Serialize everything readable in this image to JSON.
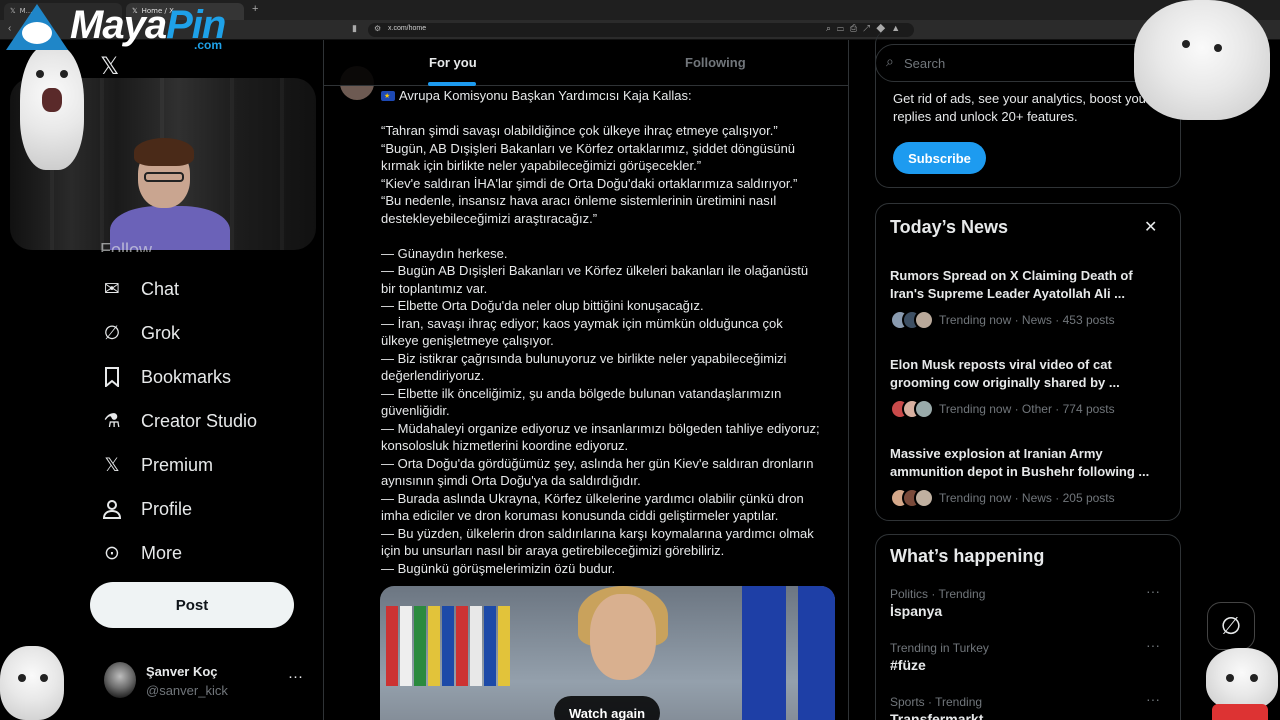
{
  "browser": {
    "tabs": [
      {
        "label": "M...",
        "active": false
      },
      {
        "label": "Home / X",
        "active": true
      }
    ],
    "new_tab": "+",
    "url": "x.com/home"
  },
  "overlay": {
    "logo_text_a": "Maya",
    "logo_text_b": "Pin",
    "logo_suffix": ".com"
  },
  "sidebar": {
    "partial_item": "Follow",
    "items": [
      {
        "label": "Chat",
        "icon": "mail-icon"
      },
      {
        "label": "Grok",
        "icon": "grok-icon"
      },
      {
        "label": "Bookmarks",
        "icon": "bookmark-icon"
      },
      {
        "label": "Creator Studio",
        "icon": "flask-icon"
      },
      {
        "label": "Premium",
        "icon": "x-logo-icon"
      },
      {
        "label": "Profile",
        "icon": "person-icon"
      },
      {
        "label": "More",
        "icon": "more-circle-icon"
      }
    ],
    "post_label": "Post",
    "account": {
      "name": "Şanver Koç",
      "handle": "@sanver_kick",
      "more": "···"
    }
  },
  "main": {
    "tabs": [
      {
        "label": "For you",
        "active": true
      },
      {
        "label": "Following",
        "active": false
      }
    ],
    "tweet": {
      "lines": [
        "Avrupa Komisyonu Başkan Yardımcısı Kaja Kallas:",
        "",
        "“Tahran şimdi savaşı olabildiğince çok ülkeye ihraç etmeye çalışıyor.”",
        "“Bugün, AB Dışişleri Bakanları ve Körfez ortaklarımız, şiddet döngüsünü",
        "kırmak için birlikte neler yapabileceğimizi görüşecekler.”",
        "“Kiev'e saldıran İHA'lar şimdi de Orta Doğu'daki ortaklarımıza saldırıyor.”",
        "“Bu nedenle, insansız hava aracı önleme sistemlerinin üretimini nasıl",
        "destekleyebileceğimizi araştıracağız.”",
        "",
        "— Günaydın herkese.",
        "— Bugün AB Dışişleri Bakanları ve Körfez ülkeleri bakanları ile olağanüstü",
        "bir toplantımız var.",
        "— Elbette Orta Doğu'da neler olup bittiğini konuşacağız.",
        "— İran, savaşı ihraç ediyor; kaos yaymak için mümkün olduğunca çok",
        "ülkeye genişletmeye çalışıyor.",
        "— Biz istikrar çağrısında bulunuyoruz ve birlikte neler yapabileceğimizi",
        "değerlendiriyoruz.",
        "— Elbette ilk önceliğimiz, şu anda bölgede bulunan vatandaşlarımızın",
        "güvenliğidir.",
        "— Müdahaleyi organize ediyoruz ve insanlarımızı bölgeden tahliye ediyoruz;",
        "konsolosluk hizmetlerini koordine ediyoruz.",
        "— Orta Doğu'da gördüğümüz şey, aslında her gün Kiev'e saldıran dronların",
        "aynısının şimdi Orta Doğu'ya da saldırdığıdır.",
        "— Burada aslında Ukrayna, Körfez ülkelerine yardımcı olabilir çünkü dron",
        "imha ediciler ve dron koruması konusunda ciddi geliştirmeler yaptılar.",
        "— Bu yüzden, ülkelerin dron saldırılarına karşı koymalarına yardımcı olmak",
        "için bu unsurları nasıl bir araya getirebileceğimizi görebiliriz.",
        "— Bugünkü görüşmelerimizin özü budur."
      ],
      "media_action": "Watch again"
    }
  },
  "right": {
    "search_placeholder": "Search",
    "premium_text": "Get rid of ads, see your analytics, boost your replies and unlock 20+ features.",
    "subscribe_label": "Subscribe",
    "news_title": "Today’s News",
    "news": [
      {
        "headline": "Rumors Spread on X Claiming Death of Iran's Supreme Leader Ayatollah Ali ...",
        "meta": "Trending now · News · 453 posts"
      },
      {
        "headline": "Elon Musk reposts viral video of cat grooming cow originally shared by ...",
        "meta": "Trending now · Other · 774 posts"
      },
      {
        "headline": "Massive explosion at Iranian Army ammunition depot in Bushehr following ...",
        "meta": "Trending now · News · 205 posts"
      }
    ],
    "happening_title": "What’s happening",
    "trends": [
      {
        "context": "Politics · Trending",
        "name": "İspanya"
      },
      {
        "context": "Trending in Turkey",
        "name": "#füze"
      },
      {
        "context": "Sports · Trending",
        "name": "Transfermarkt"
      }
    ]
  }
}
